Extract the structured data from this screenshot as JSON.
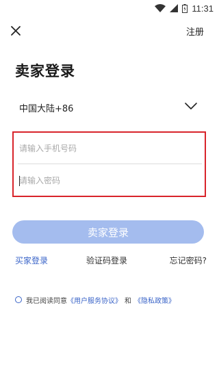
{
  "status_bar": {
    "time": "11:31",
    "icons": [
      "wifi-icon",
      "signal-icon",
      "battery-icon"
    ]
  },
  "top_bar": {
    "close_icon": "close-icon",
    "register_label": "注册"
  },
  "title": "卖家登录",
  "region": {
    "label": "中国大陆+86",
    "icon": "chevron-down-icon"
  },
  "form": {
    "phone_placeholder": "请输入手机号码",
    "password_placeholder": "请输入密码",
    "phone_value": "",
    "password_value": ""
  },
  "login_button_label": "卖家登录",
  "links": {
    "seller_login": "买家登录",
    "code_login": "验证码登录",
    "forgot_password": "忘记密码?"
  },
  "agreement": {
    "prefix": "我已阅读同意",
    "user_agreement": "《用户服务协议》",
    "and": "和",
    "privacy_policy": "《隐私政策》",
    "checked": false
  },
  "colors": {
    "accent": "#3a64c8",
    "button_disabled": "#a4bcee",
    "highlight_border": "#d8232a"
  }
}
